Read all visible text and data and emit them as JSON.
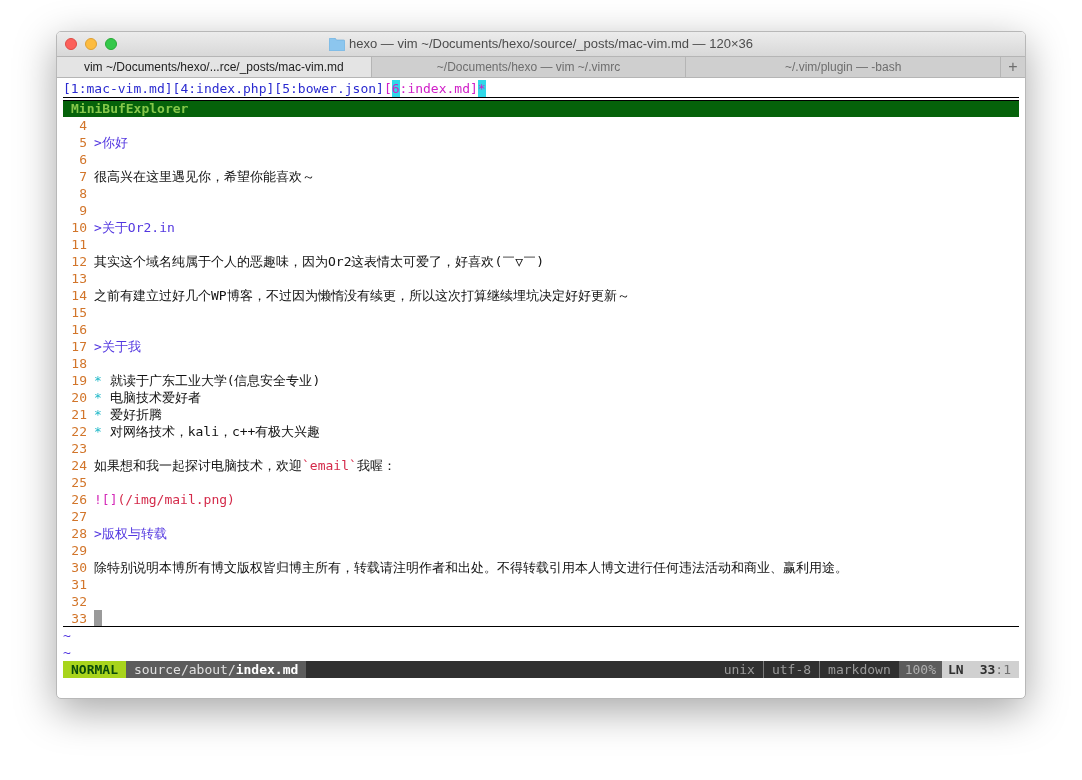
{
  "window": {
    "title": "hexo — vim ~/Documents/hexo/source/_posts/mac-vim.md — 120×36"
  },
  "tabs": [
    {
      "label": "vim ~/Documents/hexo/...rce/_posts/mac-vim.md",
      "selected": true
    },
    {
      "label": "~/Documents/hexo — vim ~/.vimrc",
      "selected": false
    },
    {
      "label": "~/.vim/plugin — -bash",
      "selected": false
    }
  ],
  "new_tab": "+",
  "buffers": [
    {
      "open": "[",
      "number": "1",
      "rest": ":mac-vim.md]",
      "selected": false
    },
    {
      "open": "[",
      "number": "4",
      "rest": ":index.php]",
      "selected": false
    },
    {
      "open": "[",
      "number": "5",
      "rest": ":bower.json]",
      "selected": false
    },
    {
      "open": "[",
      "number": "6",
      "rest": ":index.md]",
      "selected": true
    }
  ],
  "modified_mark": "*",
  "explorer_title": "MiniBufExplorer",
  "lines": [
    {
      "number": "4",
      "current": false
    },
    {
      "number": "5",
      "current": false,
      "segments": [
        {
          "kind": "heading",
          "text": ">你好"
        }
      ]
    },
    {
      "number": "6",
      "current": false
    },
    {
      "number": "7",
      "current": false,
      "segments": [
        {
          "kind": "text",
          "text": "很高兴在这里遇见你，希望你能喜欢～"
        }
      ]
    },
    {
      "number": "8",
      "current": false
    },
    {
      "number": "9",
      "current": false
    },
    {
      "number": "10",
      "current": false,
      "segments": [
        {
          "kind": "heading",
          "text": ">关于Or2.in"
        }
      ]
    },
    {
      "number": "11",
      "current": false
    },
    {
      "number": "12",
      "current": false,
      "segments": [
        {
          "kind": "text",
          "text": "其实这个域名纯属于个人的恶趣味，因为Or2这表情太可爱了，好喜欢(￣▽￣)"
        }
      ]
    },
    {
      "number": "13",
      "current": false
    },
    {
      "number": "14",
      "current": false,
      "segments": [
        {
          "kind": "text",
          "text": "之前有建立过好几个WP博客，不过因为懒惰没有续更，所以这次打算继续埋坑决定好好更新～"
        }
      ]
    },
    {
      "number": "15",
      "current": false
    },
    {
      "number": "16",
      "current": false
    },
    {
      "number": "17",
      "current": false,
      "segments": [
        {
          "kind": "heading",
          "text": ">关于我"
        }
      ]
    },
    {
      "number": "18",
      "current": false
    },
    {
      "number": "19",
      "current": false,
      "segments": [
        {
          "kind": "bullet",
          "text": "*"
        },
        {
          "kind": "text",
          "text": " 就读于广东工业大学(信息安全专业)"
        }
      ]
    },
    {
      "number": "20",
      "current": false,
      "segments": [
        {
          "kind": "bullet",
          "text": "*"
        },
        {
          "kind": "text",
          "text": " 电脑技术爱好者"
        }
      ]
    },
    {
      "number": "21",
      "current": false,
      "segments": [
        {
          "kind": "bullet",
          "text": "*"
        },
        {
          "kind": "text",
          "text": " 爱好折腾"
        }
      ]
    },
    {
      "number": "22",
      "current": false,
      "segments": [
        {
          "kind": "bullet",
          "text": "*"
        },
        {
          "kind": "text",
          "text": " 对网络技术，kali，c++有极大兴趣"
        }
      ]
    },
    {
      "number": "23",
      "current": false
    },
    {
      "number": "24",
      "current": false,
      "segments": [
        {
          "kind": "text",
          "text": "如果想和我一起探讨电脑技术，欢迎"
        },
        {
          "kind": "code",
          "text": "`email`"
        },
        {
          "kind": "text",
          "text": "我喔："
        }
      ]
    },
    {
      "number": "25",
      "current": false
    },
    {
      "number": "26",
      "current": false,
      "segments": [
        {
          "kind": "link_mark",
          "text": "![]"
        },
        {
          "kind": "url",
          "text": "(/img/mail.png)"
        }
      ]
    },
    {
      "number": "27",
      "current": false
    },
    {
      "number": "28",
      "current": false,
      "segments": [
        {
          "kind": "heading",
          "text": ">版权与转载"
        }
      ]
    },
    {
      "number": "29",
      "current": false
    },
    {
      "number": "30",
      "current": false,
      "segments": [
        {
          "kind": "text",
          "text": "除特别说明本博所有博文版权皆归博主所有，转载请注明作者和出处。不得转载引用本人博文进行任何违法活动和商业、赢利用途。"
        }
      ]
    },
    {
      "number": "31",
      "current": false
    },
    {
      "number": "32",
      "current": false
    },
    {
      "number": "33",
      "current": true
    }
  ],
  "tildes": [
    "~",
    "~"
  ],
  "status_bar": {
    "mode": "NORMAL",
    "path": "source/about/",
    "file": "index.md",
    "format": "unix",
    "encoding": "utf-8",
    "filetype": "markdown",
    "percent": "100%",
    "ln_label": "LN",
    "line": "33",
    "column": ":1"
  }
}
